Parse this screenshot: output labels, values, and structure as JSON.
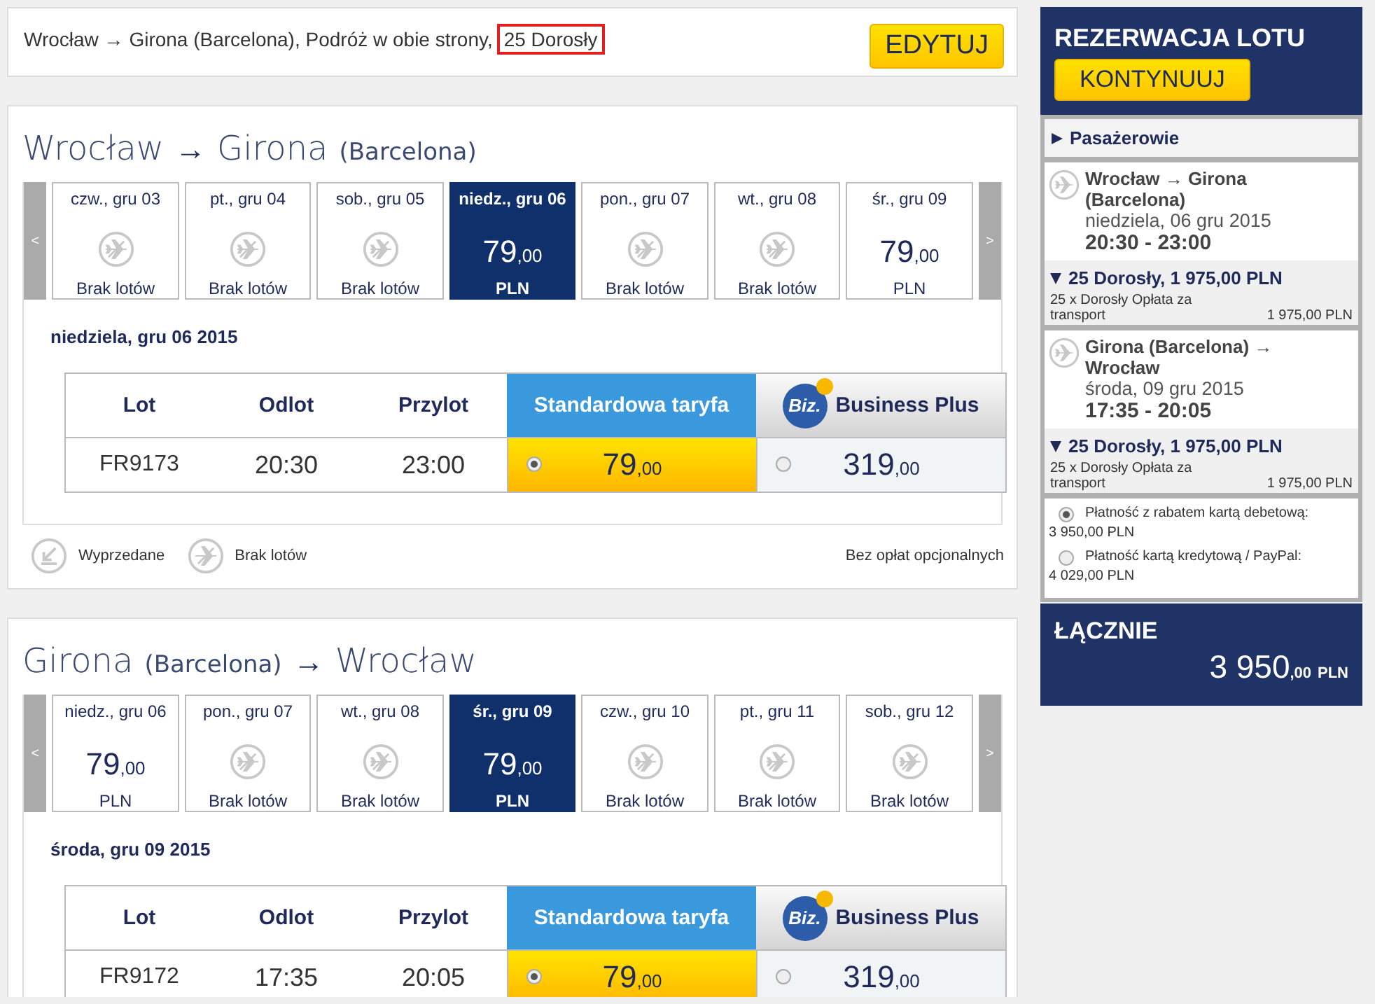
{
  "summary": {
    "text": "Wrocław → Girona (Barcelona), Podróż w obie strony,",
    "highlight": "25 Dorosły",
    "edit_button": "EDYTUJ"
  },
  "legs": [
    {
      "origin": "Wrocław",
      "arrow": "→",
      "destination": "Girona",
      "destination_note": "(Barcelona)",
      "prev": "<",
      "next": ">",
      "days": [
        {
          "label": "czw., gru 03",
          "kind": "none",
          "note": "Brak lotów",
          "selected": false
        },
        {
          "label": "pt., gru 04",
          "kind": "none",
          "note": "Brak lotów",
          "selected": false
        },
        {
          "label": "sob., gru 05",
          "kind": "none",
          "note": "Brak lotów",
          "selected": false
        },
        {
          "label": "niedz., gru 06",
          "kind": "price",
          "price": "79",
          "decimals": ",00",
          "note": "PLN",
          "selected": true
        },
        {
          "label": "pon., gru 07",
          "kind": "none",
          "note": "Brak lotów",
          "selected": false
        },
        {
          "label": "wt., gru 08",
          "kind": "none",
          "note": "Brak lotów",
          "selected": false
        },
        {
          "label": "śr., gru 09",
          "kind": "price",
          "price": "79",
          "decimals": ",00",
          "note": "PLN",
          "selected": false
        }
      ],
      "date_heading": "niedziela, gru 06 2015",
      "columns": [
        "Lot",
        "Odlot",
        "Przylot"
      ],
      "fares": [
        {
          "kind": "standard",
          "name": "Standardowa taryfa"
        },
        {
          "kind": "business",
          "logo": "Biz.",
          "name": "Business Plus"
        }
      ],
      "row": {
        "flight": "FR9173",
        "departure": "20:30",
        "arrival": "23:00",
        "prices": [
          {
            "price": "79",
            "decimals": ",00",
            "selected": true
          },
          {
            "price": "319",
            "decimals": ",00",
            "selected": false
          }
        ]
      },
      "legend": [
        {
          "kind": "sold_out",
          "label": "Wyprzedane"
        },
        {
          "kind": "none",
          "label": "Brak lotów"
        }
      ],
      "legend_note": "Bez opłat opcjonalnych"
    },
    {
      "origin": "Girona",
      "origin_note": "(Barcelona)",
      "arrow": "→",
      "destination": "Wrocław",
      "prev": "<",
      "next": ">",
      "days": [
        {
          "label": "niedz., gru 06",
          "kind": "price",
          "price": "79",
          "decimals": ",00",
          "note": "PLN",
          "selected": false
        },
        {
          "label": "pon., gru 07",
          "kind": "none",
          "note": "Brak lotów",
          "selected": false
        },
        {
          "label": "wt., gru 08",
          "kind": "none",
          "note": "Brak lotów",
          "selected": false
        },
        {
          "label": "śr., gru 09",
          "kind": "price",
          "price": "79",
          "decimals": ",00",
          "note": "PLN",
          "selected": true
        },
        {
          "label": "czw., gru 10",
          "kind": "none",
          "note": "Brak lotów",
          "selected": false
        },
        {
          "label": "pt., gru 11",
          "kind": "none",
          "note": "Brak lotów",
          "selected": false
        },
        {
          "label": "sob., gru 12",
          "kind": "none",
          "note": "Brak lotów",
          "selected": false
        }
      ],
      "date_heading": "środa, gru 09 2015",
      "columns": [
        "Lot",
        "Odlot",
        "Przylot"
      ],
      "fares": [
        {
          "kind": "standard",
          "name": "Standardowa taryfa"
        },
        {
          "kind": "business",
          "logo": "Biz.",
          "name": "Business Plus"
        }
      ],
      "row": {
        "flight": "FR9172",
        "departure": "17:35",
        "arrival": "20:05",
        "prices": [
          {
            "price": "79",
            "decimals": ",00",
            "selected": true
          },
          {
            "price": "319",
            "decimals": ",00",
            "selected": false
          }
        ]
      }
    }
  ],
  "sidebar": {
    "title": "REZERWACJA LOTU",
    "continue_button": "KONTYNUUJ",
    "passengers": "Pasażerowie",
    "flights": [
      {
        "route": "Wrocław → Girona (Barcelona)",
        "date": "niedziela, 06 gru 2015",
        "time": "20:30 - 23:00",
        "fare_summary": "25 Dorosły, 1 975,00 PLN",
        "fare_detail": "25 x Dorosły Opłata za transport",
        "fare_amount": "1 975,00 PLN"
      },
      {
        "route": "Girona (Barcelona) → Wrocław",
        "date": "środa, 09 gru 2015",
        "time": "17:35 - 20:05",
        "fare_summary": "25 Dorosły, 1 975,00 PLN",
        "fare_detail": "25 x Dorosły Opłata za transport",
        "fare_amount": "1 975,00 PLN"
      }
    ],
    "payments": [
      {
        "label": "Płatność z rabatem kartą debetową:",
        "amount": "3 950,00 PLN",
        "selected": true
      },
      {
        "label": "Płatność kartą kredytową / PayPal:",
        "amount": "4 029,00 PLN",
        "selected": false
      }
    ],
    "total_label": "ŁĄCZNIE",
    "total": "3 950",
    "total_decimals": ",00",
    "total_currency": "PLN"
  }
}
